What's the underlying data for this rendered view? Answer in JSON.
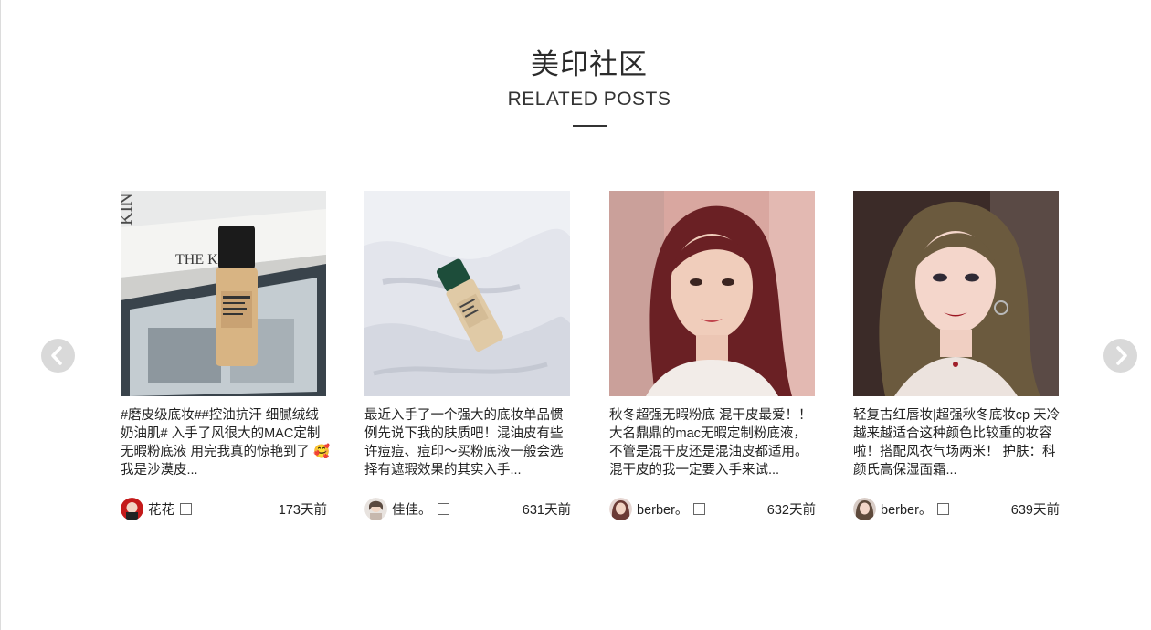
{
  "section": {
    "title_cn": "美印社区",
    "title_en": "RELATED POSTS"
  },
  "carousel": {
    "prev_icon": "chevron-left-icon",
    "next_icon": "chevron-right-icon",
    "arrow_color": "#d9d9d9"
  },
  "posts": [
    {
      "text": "#磨皮级底妆##控油抗汗 细腻绒绒奶油肌# 入手了风很大的MAC定制无暇粉底液 用完我真的惊艳到了 🥰 我是沙漠皮...",
      "author": "花花",
      "time": "173天前"
    },
    {
      "text": "最近入手了一个强大的底妆单品惯例先说下我的肤质吧！混油皮有些许痘痘、痘印～买粉底液一般会选择有遮瑕效果的其实入手...",
      "author": "佳佳。",
      "time": "631天前"
    },
    {
      "text": "秋冬超强无暇粉底 混干皮最爱！！大名鼎鼎的mac无暇定制粉底液，不管是混干皮还是混油皮都适用。混干皮的我一定要入手来试...",
      "author": "berber。",
      "time": "632天前"
    },
    {
      "text": "轻复古红唇妆|超强秋冬底妆cp 天冷越来越适合这种颜色比较重的妆容啦！搭配风衣气场两米！ 护肤：科颜氏高保湿面霜...",
      "author": "berber。",
      "time": "639天前"
    }
  ]
}
